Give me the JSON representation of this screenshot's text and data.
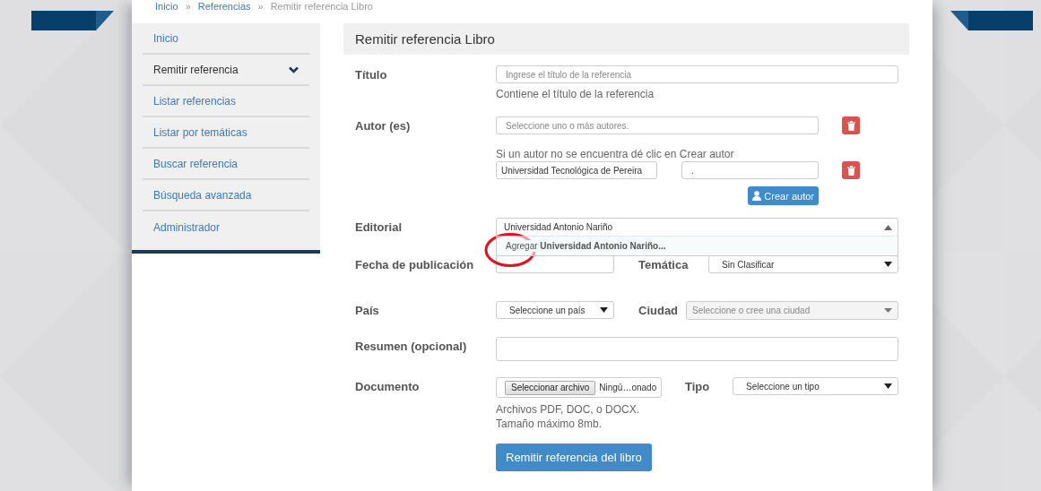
{
  "breadcrumb": {
    "separator": "»",
    "items": [
      "Inicio",
      "Referencias",
      "Remitir referencia Libro"
    ]
  },
  "sidebar": {
    "items": [
      {
        "label": "Inicio",
        "selected": false,
        "kind": "link"
      },
      {
        "label": "Remitir referencia",
        "selected": true,
        "kind": "submenu"
      },
      {
        "label": "Listar referencias",
        "selected": false,
        "kind": "link"
      },
      {
        "label": "Listar por temáticas",
        "selected": false,
        "kind": "link"
      },
      {
        "label": "Buscar referencia",
        "selected": false,
        "kind": "link"
      },
      {
        "label": "Búsqueda avanzada",
        "selected": false,
        "kind": "link"
      },
      {
        "label": "Administrador",
        "selected": false,
        "kind": "link"
      }
    ]
  },
  "form": {
    "title": "Remitir referencia Libro",
    "titulo": {
      "label": "Título",
      "placeholder": "Ingrese el título de la referencia",
      "help": "Contiene el título de la referencia"
    },
    "autores": {
      "label": "Autor (es)",
      "placeholder": "Seleccione uno o más autores.",
      "help": "Si un autor no se encuentra dé clic en Crear autor",
      "new_author_name": "Universidad Tecnológica de Pereira",
      "new_author_second": ".",
      "create_button": "Crear autor"
    },
    "editorial": {
      "label": "Editorial",
      "value": "Universidad Antonio Nariño",
      "expanded": true,
      "option": "Agregar **Universidad Antonio Nariño...**"
    },
    "fecha": {
      "label": "Fecha de publicación"
    },
    "tematica": {
      "label": "Temática",
      "value": "Sin Clasificar"
    },
    "pais": {
      "label": "País",
      "value": "Seleccione un país"
    },
    "ciudad": {
      "label": "Ciudad",
      "placeholder": "Seleccione o cree una ciudad"
    },
    "resumen": {
      "label": "Resumen (opcional)"
    },
    "documento": {
      "label": "Documento",
      "button": "Seleccionar archivo",
      "filename": "Ningú…onado",
      "help": [
        "Archivos PDF, DOC, o DOCX.",
        "Tamaño máximo 8mb."
      ]
    },
    "tipo": {
      "label": "Tipo",
      "value": "Seleccione un tipo"
    },
    "submit": "Remitir referencia del libro"
  }
}
